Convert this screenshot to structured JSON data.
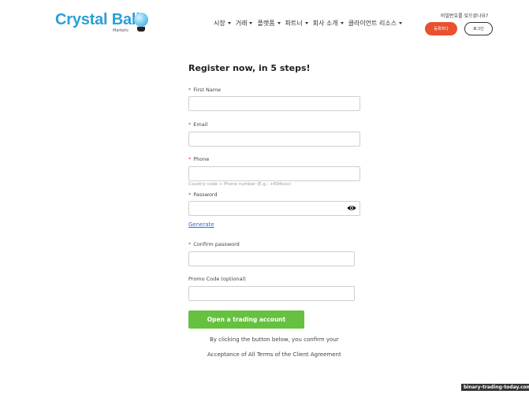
{
  "header": {
    "logo_main": "Crystal Ball",
    "logo_sub": "Markets",
    "nav": [
      {
        "label": "시장"
      },
      {
        "label": "거래"
      },
      {
        "label": "플랫폼"
      },
      {
        "label": "파트너"
      },
      {
        "label": "회사 소개"
      },
      {
        "label": "클라이언트 리소스"
      }
    ],
    "forgot_password": "비밀번호를 잊으셨나요?",
    "register_label": "등록하다",
    "login_label": "로그인"
  },
  "form": {
    "title": "Register now, in 5 steps!",
    "first_name_label": "First Name",
    "email_label": "Email",
    "phone_label": "Phone",
    "phone_hint": "Country code + Phone number (E.g.: +694xxx)",
    "password_label": "Password",
    "generate_label": "Generate",
    "confirm_password_label": "Confirm password",
    "promo_label": "Promo Code (optional)",
    "required_marker": "*",
    "submit_label": "Open a trading account",
    "consent_line1": "By clicking the button below, you confirm your",
    "consent_line2": "Acceptance of All Terms of the Client Agreement"
  },
  "watermark": "binary-trading-today.com",
  "colors": {
    "brand_blue": "#2a9fd8",
    "register_red": "#e8512f",
    "submit_green": "#65c13f",
    "link_blue": "#2f6fd0",
    "required_red": "#e03b24"
  },
  "icons": {
    "password_toggle": "eye-icon"
  }
}
